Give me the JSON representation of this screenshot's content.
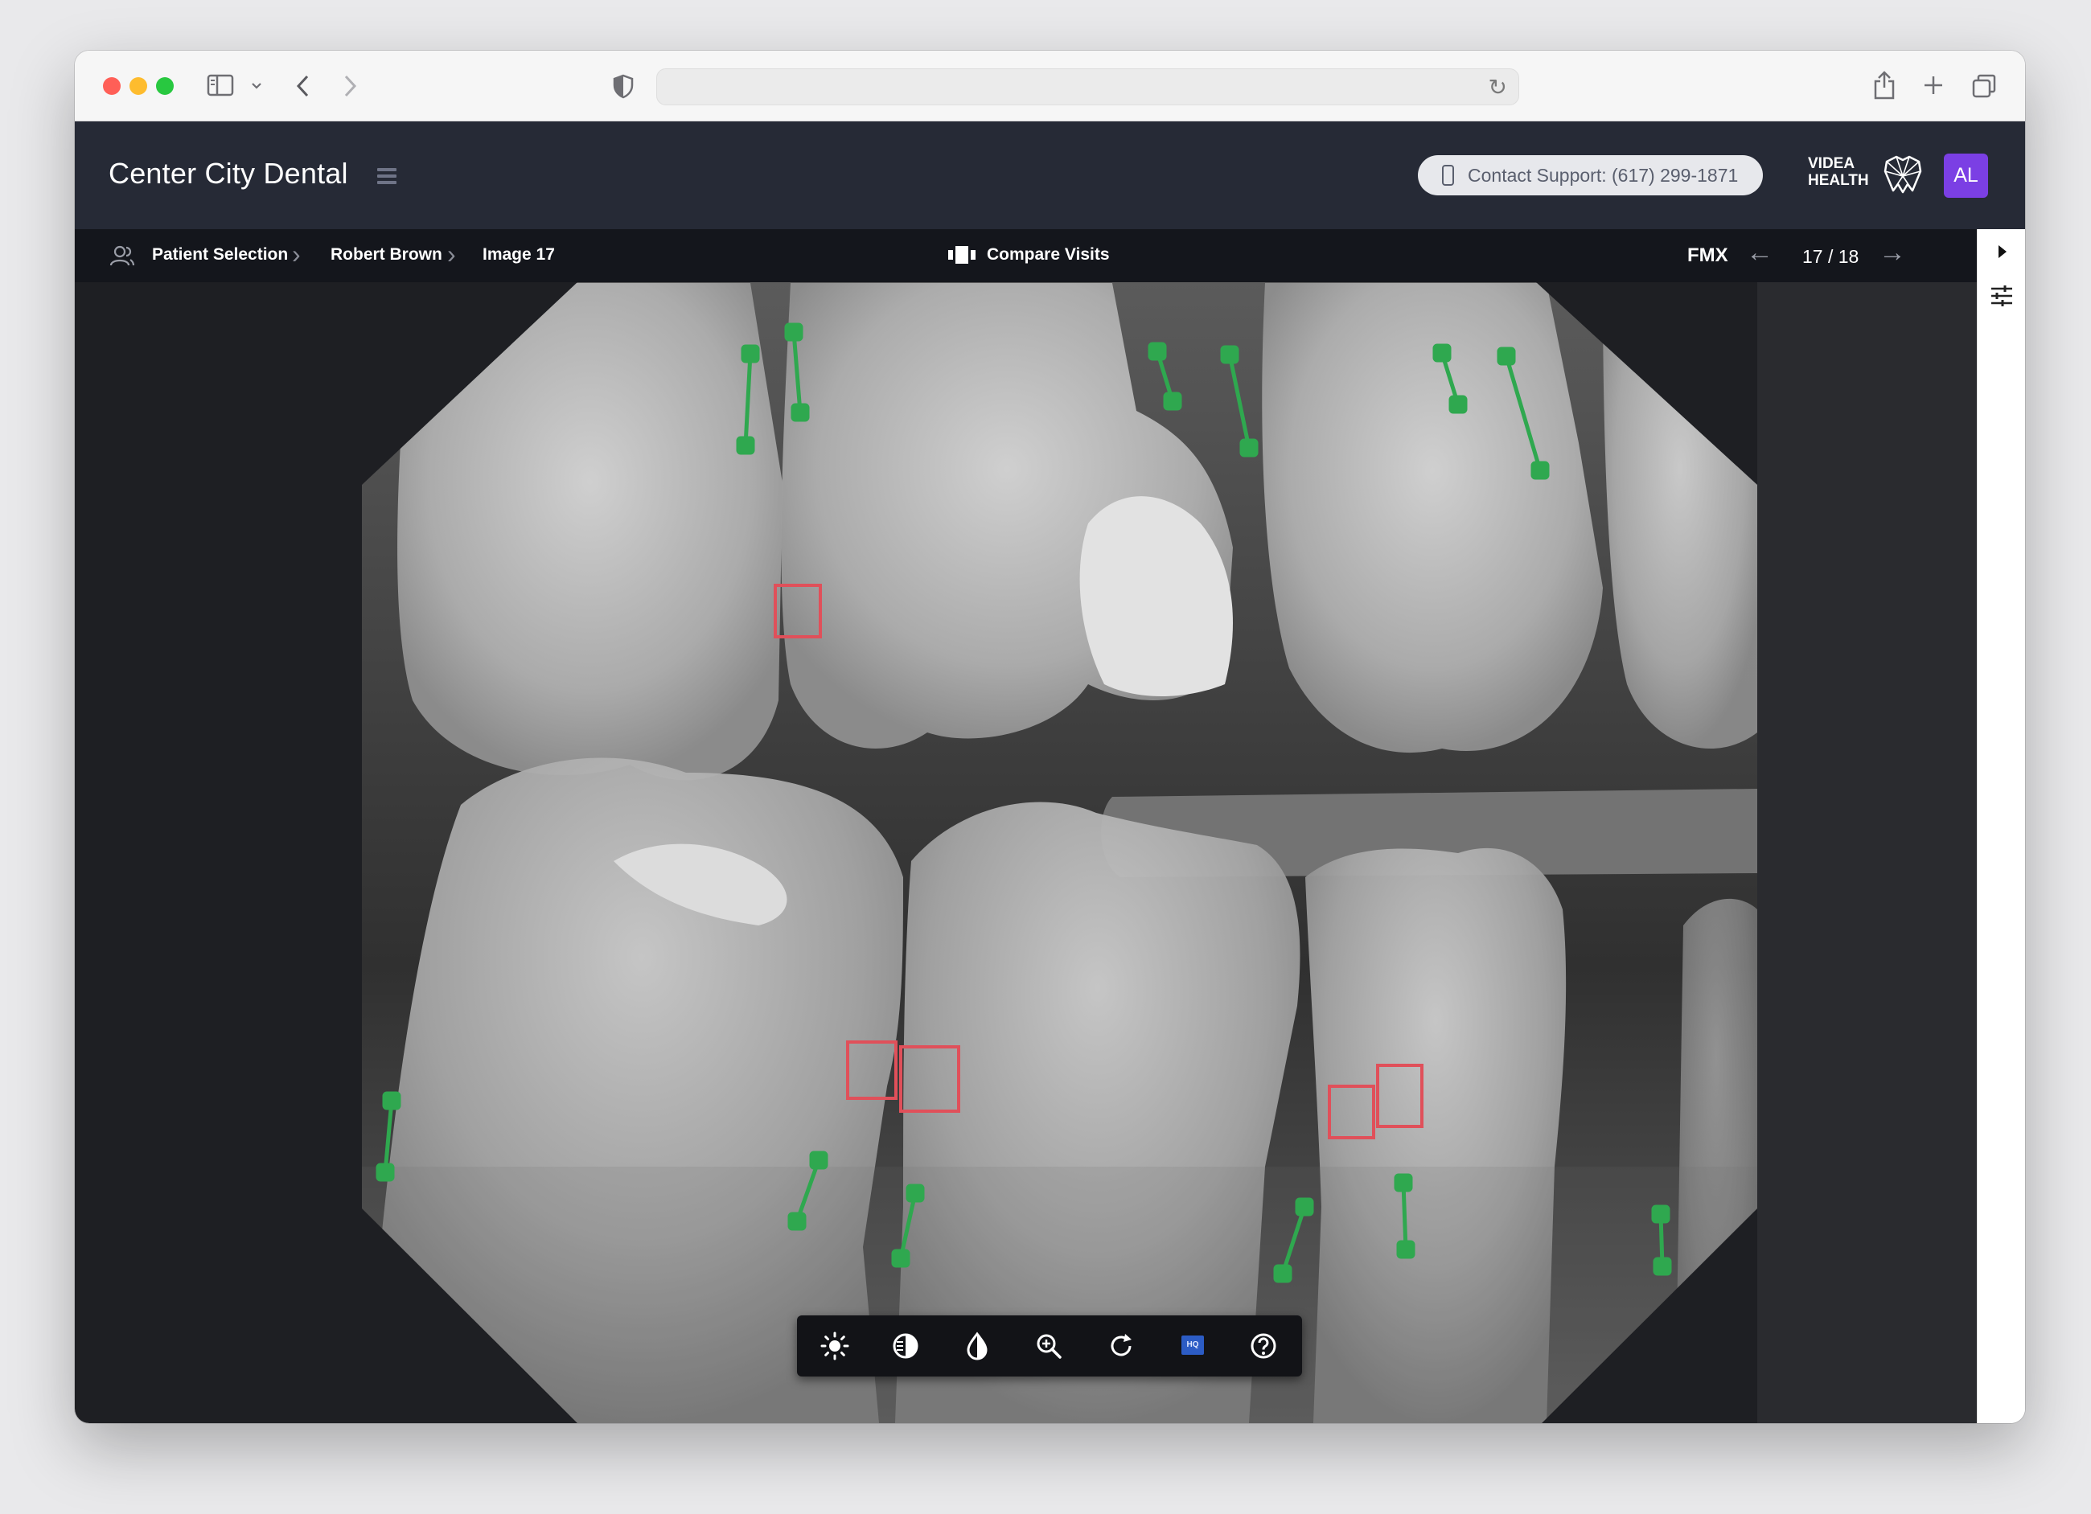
{
  "header": {
    "clinic_name": "Center City Dental",
    "support_label": "Contact Support: (617) 299-1871",
    "brand_line1": "VIDEA",
    "brand_line2": "HEALTH",
    "user_initials": "AL",
    "avatar_color": "#7b3fe4"
  },
  "toolbar": {
    "breadcrumbs": [
      "Patient Selection",
      "Robert Brown",
      "Image 17"
    ],
    "compare_label": "Compare Visits",
    "series_label": "FMX",
    "pager": "17 / 18"
  },
  "image_tools": {
    "icons": [
      "brightness-icon",
      "contrast-icon",
      "invert-icon",
      "zoom-in-icon",
      "rotate-icon",
      "hq-icon",
      "help-icon"
    ],
    "hq_label": "HQ"
  },
  "annotations": {
    "bone_level_color": "#2fa84f",
    "caries_color": "#e0505a"
  }
}
